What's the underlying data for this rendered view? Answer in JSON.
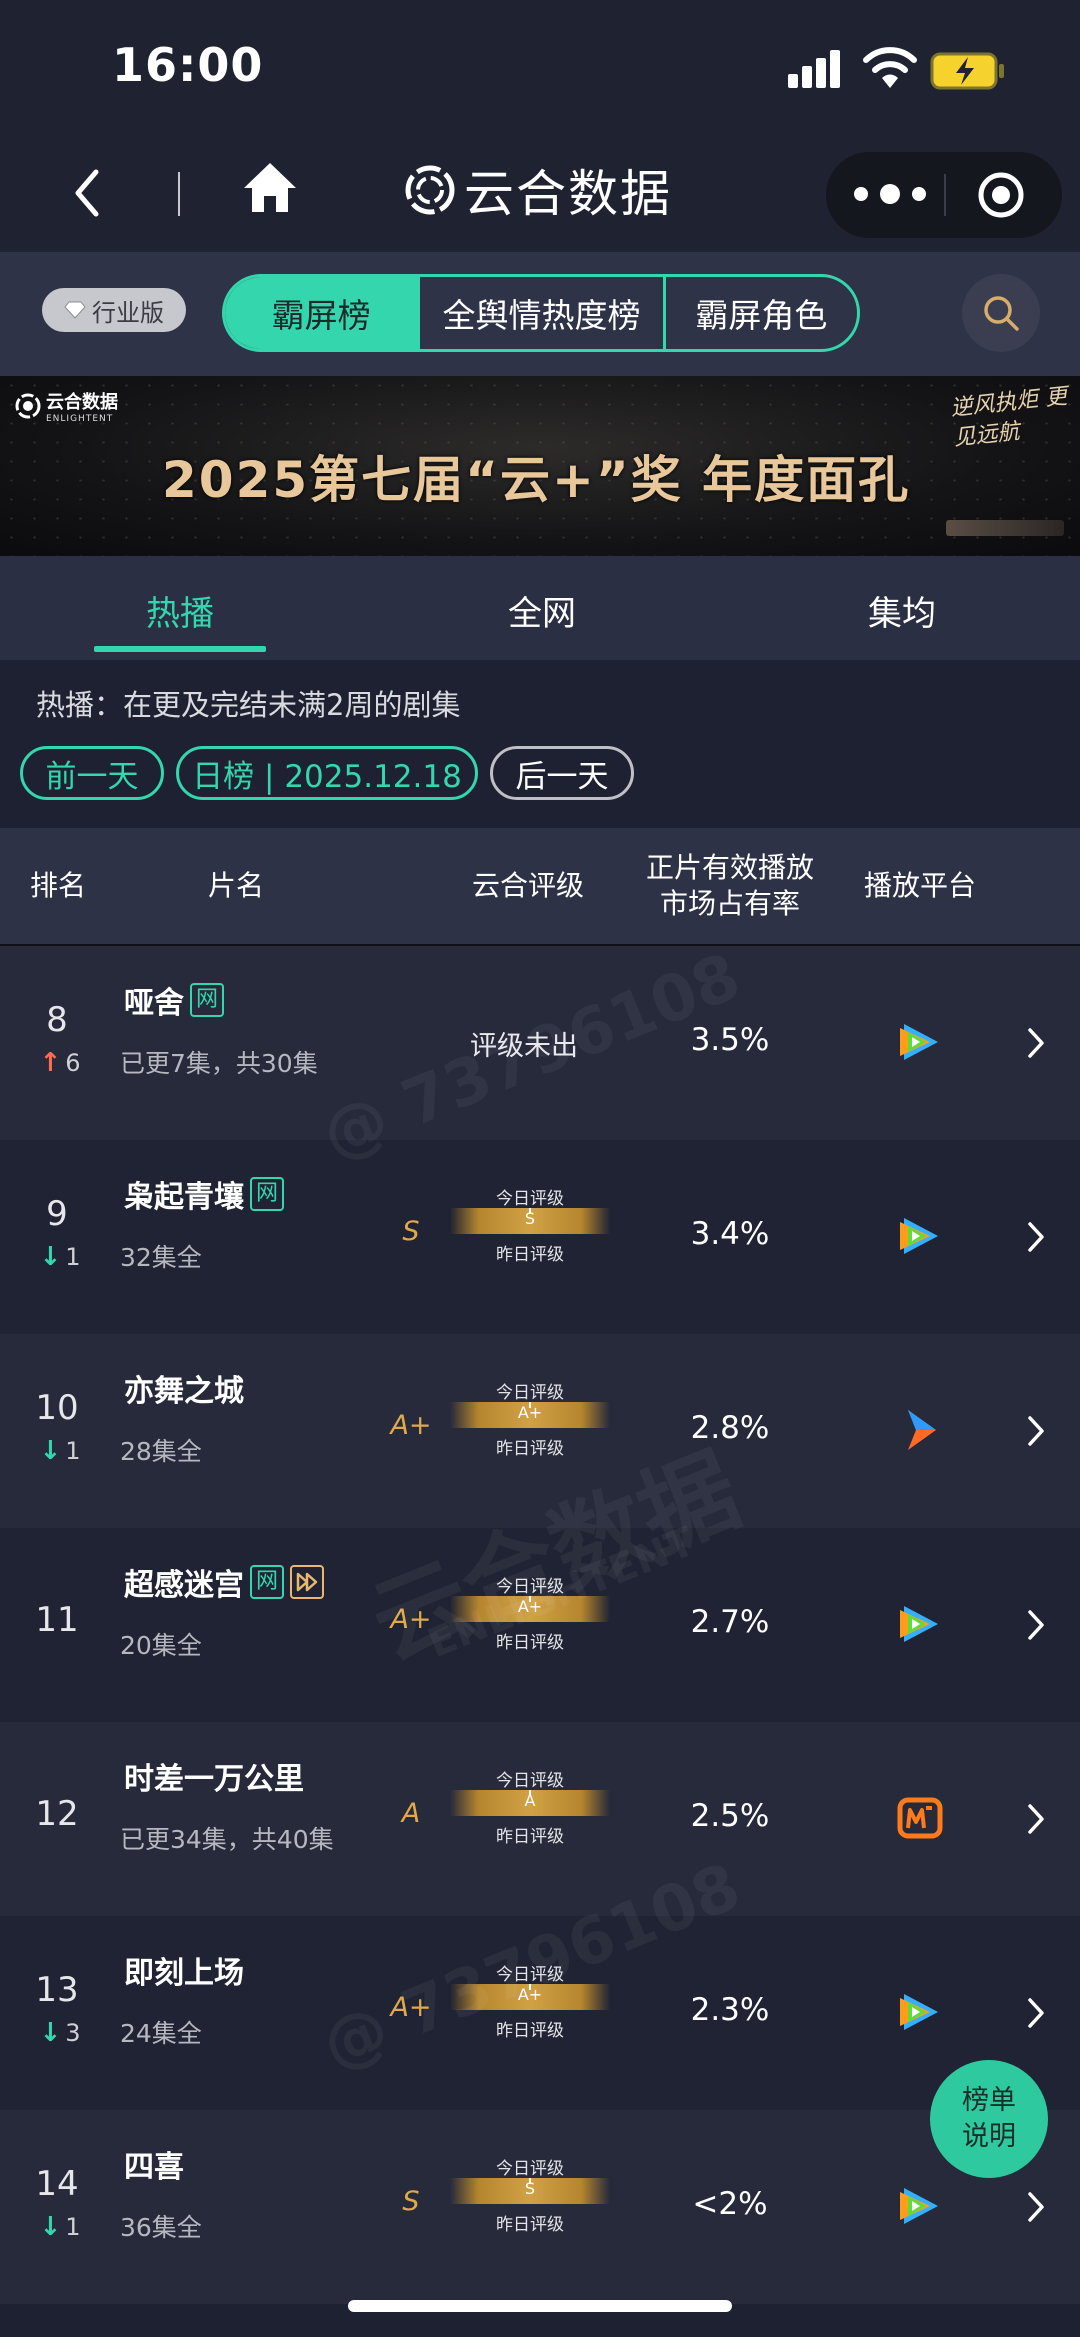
{
  "status_bar": {
    "time": "16:00"
  },
  "app": {
    "title": "云合数据"
  },
  "filter": {
    "edition": "行业版",
    "segments": [
      "霸屏榜",
      "全舆情热度榜",
      "霸屏角色"
    ]
  },
  "banner": {
    "logo_cn": "云合数据",
    "logo_en": "ENLIGHTENT",
    "title": "2025第七届“云+”奖  年度面孔",
    "slogan": "逆风执炬 更见远航"
  },
  "tabs": [
    "热播",
    "全网",
    "集均"
  ],
  "info": {
    "description": "热播：在更及完结未满2周的剧集",
    "prev_label": "前一天",
    "date_label": "日榜 | 2025.12.18",
    "next_label": "后一天"
  },
  "table": {
    "headers": {
      "rank": "排名",
      "title": "片名",
      "grade": "云合评级",
      "share_line1": "正片有效播放",
      "share_line2": "市场占有率",
      "platform": "播放平台"
    },
    "grade_today_label": "今日评级",
    "grade_yesterday_label": "昨日评级",
    "rows": [
      {
        "rank": "8",
        "change": "6",
        "direction": "up",
        "title": "哑舍",
        "tags": [
          "网"
        ],
        "episodes": "已更7集，共30集",
        "grade": "评级未出",
        "grade_bar": "",
        "share": "3.5%",
        "platform": "tencent-video"
      },
      {
        "rank": "9",
        "change": "1",
        "direction": "down",
        "title": "枭起青壤",
        "tags": [
          "网"
        ],
        "episodes": "32集全",
        "grade": "S",
        "grade_bar": "S",
        "share": "3.4%",
        "platform": "tencent-video"
      },
      {
        "rank": "10",
        "change": "1",
        "direction": "down",
        "title": "亦舞之城",
        "tags": [],
        "episodes": "28集全",
        "grade": "A+",
        "grade_bar": "A+",
        "share": "2.8%",
        "platform": "youku"
      },
      {
        "rank": "11",
        "change": "",
        "direction": "none",
        "title": "超感迷宫",
        "tags": [
          "网",
          "ff"
        ],
        "episodes": "20集全",
        "grade": "A+",
        "grade_bar": "A+",
        "share": "2.7%",
        "platform": "tencent-video"
      },
      {
        "rank": "12",
        "change": "",
        "direction": "none",
        "title": "时差一万公里",
        "tags": [],
        "episodes": "已更34集，共40集",
        "grade": "A",
        "grade_bar": "A",
        "share": "2.5%",
        "platform": "mango-tv"
      },
      {
        "rank": "13",
        "change": "3",
        "direction": "down",
        "title": "即刻上场",
        "tags": [],
        "episodes": "24集全",
        "grade": "A+",
        "grade_bar": "A+",
        "share": "2.3%",
        "platform": "tencent-video"
      },
      {
        "rank": "14",
        "change": "1",
        "direction": "down",
        "title": "四喜",
        "tags": [],
        "episodes": "36集全",
        "grade": "S",
        "grade_bar": "S",
        "share": "<2%",
        "platform": "tencent-video"
      }
    ]
  },
  "watermarks": [
    "@ 73796108",
    "云合数据",
    "ENLIGHTENT",
    "@ 73796108"
  ],
  "fab": {
    "line1": "榜单",
    "line2": "说明"
  },
  "colors": {
    "accent": "#33d6ad",
    "background": "#1e2131",
    "gold": "#e2a94a",
    "up": "#ff6b50"
  }
}
